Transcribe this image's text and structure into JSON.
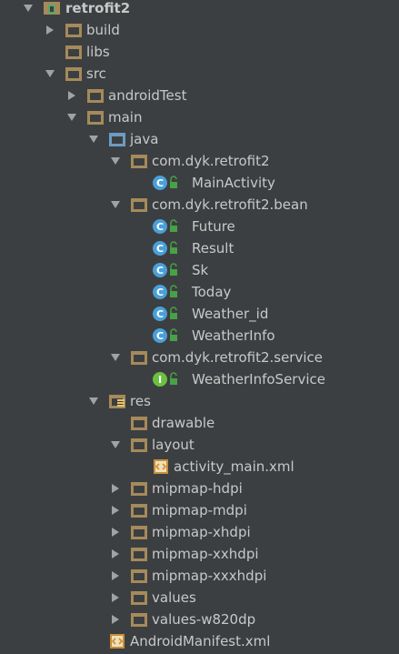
{
  "tree": {
    "root_label": "retrofit2",
    "build": "build",
    "libs": "libs",
    "src": "src",
    "androidTest": "androidTest",
    "main": "main",
    "java": "java",
    "pkg_main": "com.dyk.retrofit2",
    "main_activity": "MainActivity",
    "pkg_bean": "com.dyk.retrofit2.bean",
    "future": "Future",
    "result": "Result",
    "sk": "Sk",
    "today": "Today",
    "weather_id": "Weather_id",
    "weather_info": "WeatherInfo",
    "pkg_service": "com.dyk.retrofit2.service",
    "weather_info_service": "WeatherInfoService",
    "res": "res",
    "drawable": "drawable",
    "layout": "layout",
    "activity_main_xml": "activity_main.xml",
    "mipmap_hdpi": "mipmap-hdpi",
    "mipmap_mdpi": "mipmap-mdpi",
    "mipmap_xhdpi": "mipmap-xhdpi",
    "mipmap_xxhdpi": "mipmap-xxhdpi",
    "mipmap_xxxhdpi": "mipmap-xxxhdpi",
    "values": "values",
    "values_w820dp": "values-w820dp",
    "android_manifest": "AndroidManifest.xml"
  },
  "icons": {
    "folder": "folder-icon",
    "source_folder": "source-folder-icon",
    "resource_folder": "resource-folder-icon",
    "module": "module-icon",
    "package": "package-icon",
    "class": "class-icon",
    "interface": "interface-icon",
    "xml": "xml-file-icon",
    "manifest": "manifest-file-icon",
    "lock_badge": "lock-badge-icon"
  },
  "colors": {
    "background": "#3c3f41",
    "text": "#c8c8c8",
    "arrow": "#9ea3a7",
    "folder": "#a58a5a",
    "source_folder": "#6d9bc3",
    "class": "#4aa0d8",
    "interface": "#6cc040",
    "lock": "#47a147"
  }
}
